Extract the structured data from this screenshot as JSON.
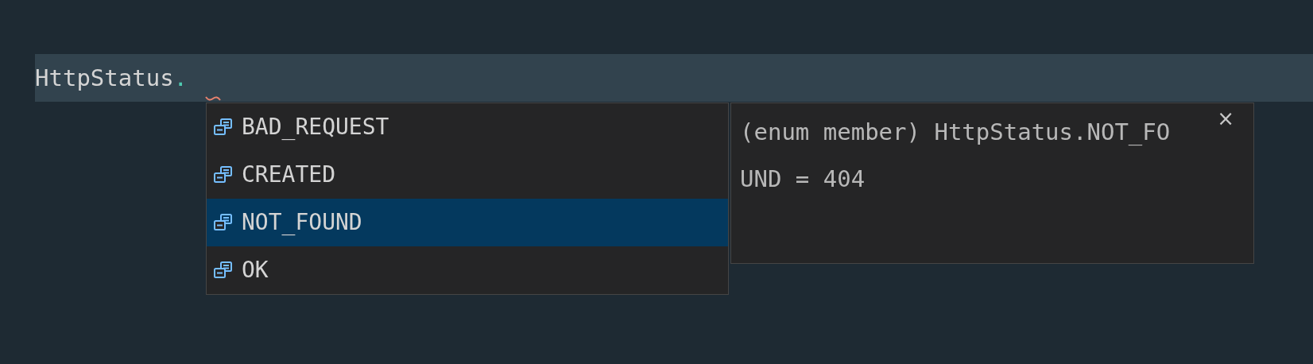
{
  "editor": {
    "line_tokens": [
      {
        "text": "HttpStatus",
        "kind": "identifier"
      },
      {
        "text": ".",
        "kind": "punctuation"
      }
    ],
    "error_squiggle": true
  },
  "suggestions": [
    {
      "label": "BAD_REQUEST",
      "selected": false
    },
    {
      "label": "CREATED",
      "selected": false
    },
    {
      "label": "NOT_FOUND",
      "selected": true
    },
    {
      "label": "OK",
      "selected": false
    }
  ],
  "details": {
    "lines": [
      "(enum member) HttpStatus.NOT_FO",
      "UND = 404"
    ],
    "close": "×"
  }
}
